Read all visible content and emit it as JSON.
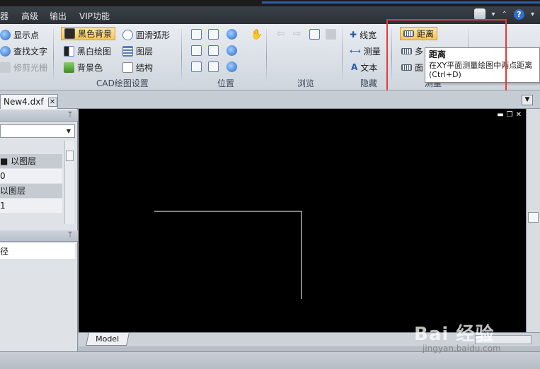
{
  "menubar": {
    "items": [
      "器",
      "高级",
      "输出",
      "VIP功能"
    ]
  },
  "ribbon": {
    "col1": [
      "显示点",
      "查找文字",
      "修剪光栅"
    ],
    "col2": [
      "黑色背景",
      "黑白绘图",
      "背景色"
    ],
    "col3": [
      "圆滑弧形",
      "图层",
      "结构"
    ],
    "group_cad": "CAD绘图设置",
    "group_position": "位置",
    "group_browse": "浏览",
    "hide": [
      "线宽",
      "测量",
      "文本"
    ],
    "group_hide": "隐藏",
    "measure": [
      "距离",
      "多",
      "面"
    ],
    "group_measure": "测量"
  },
  "tooltip": {
    "title": "距离",
    "body": "在XY平面测量绘图中两点距离",
    "shortcut": "(Ctrl+D)"
  },
  "tabs": {
    "doc": "New4.dxf"
  },
  "left_panel": {
    "rows": [
      "■ 以图层",
      "0",
      "以图层",
      "1"
    ],
    "path_label": "径"
  },
  "canvas": {
    "model_tab": "Model"
  },
  "watermark": {
    "main": "Bai 经验",
    "sub": "jingyan.baidu.com"
  },
  "colors": {
    "accent_red": "#e23b3b",
    "active_button": "#f7c65a",
    "canvas_bg": "#000000"
  }
}
